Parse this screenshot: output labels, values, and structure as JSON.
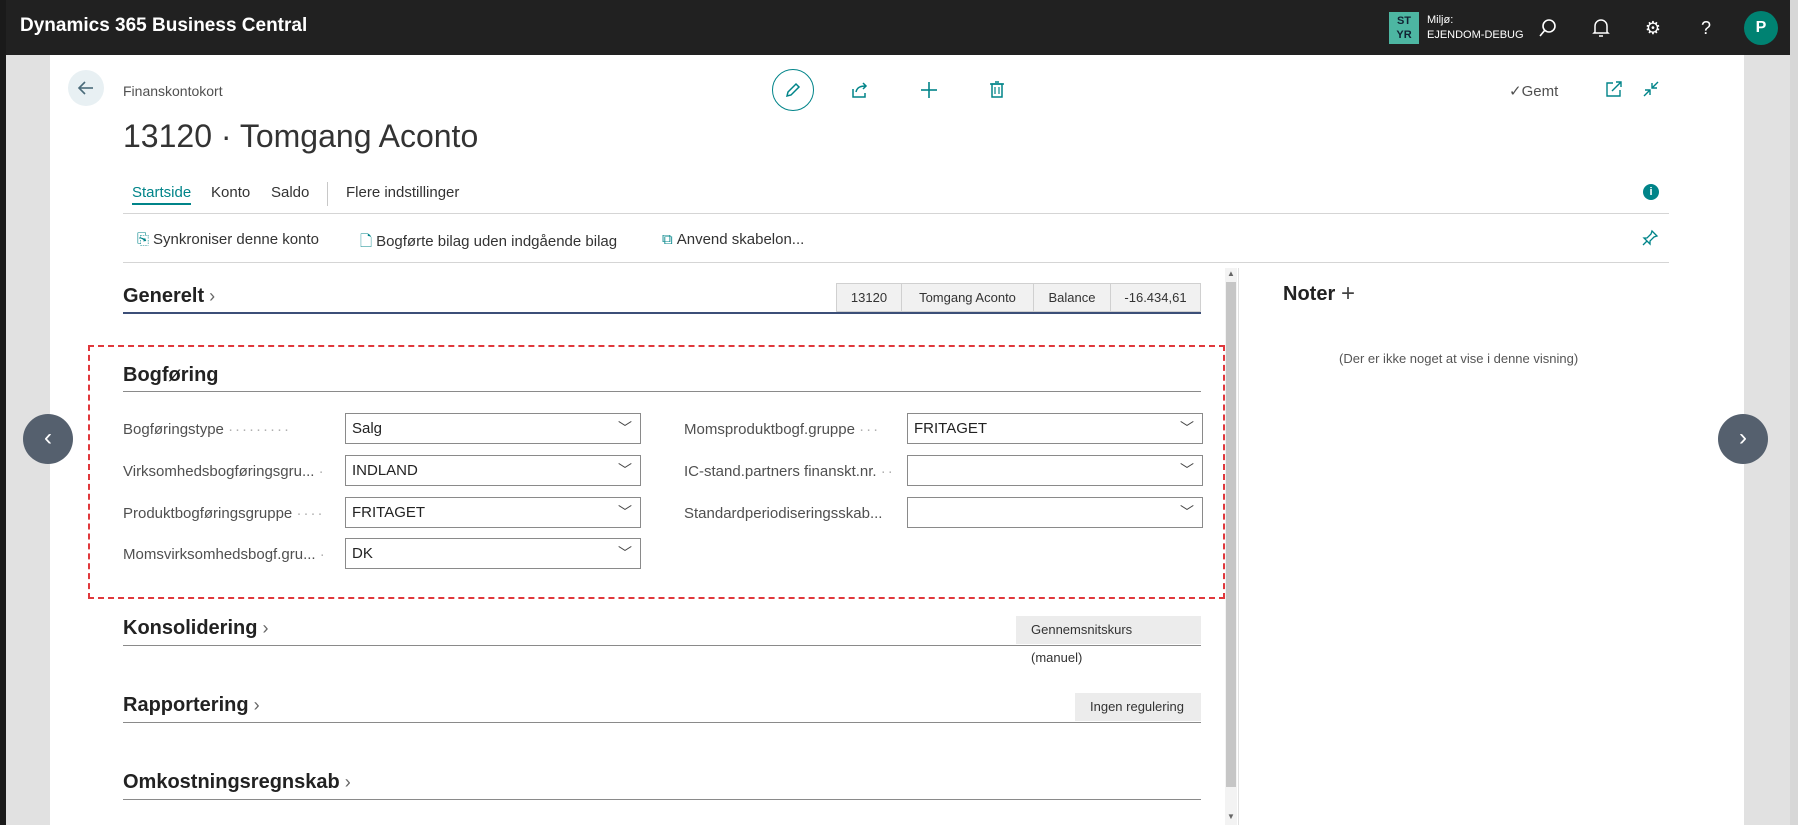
{
  "app": {
    "title": "Dynamics 365 Business Central"
  },
  "env": {
    "badge_top": "ST",
    "badge_bottom": "YR",
    "label_top": "Miljø:",
    "label_bottom": "EJENDOM-DEBUG"
  },
  "user": {
    "initial": "P"
  },
  "page": {
    "breadcrumb": "Finanskontokort",
    "title": "13120 · Tomgang Aconto",
    "saved_label": "Gemt"
  },
  "tabs": [
    "Startside",
    "Konto",
    "Saldo",
    "Flere indstillinger"
  ],
  "toolbar": {
    "sync": "Synkroniser denne konto",
    "posted_docs": "Bogførte bilag uden indgående bilag",
    "apply_template": "Anvend skabelon..."
  },
  "general": {
    "title": "Generelt",
    "facts": [
      "13120",
      "Tomgang Aconto",
      "Balance",
      "-16.434,61"
    ]
  },
  "posting": {
    "title": "Bogføring",
    "fields_left": [
      {
        "label": "Bogføringstype",
        "value": "Salg"
      },
      {
        "label": "Virksomhedsbogføringsgru...",
        "value": "INDLAND"
      },
      {
        "label": "Produktbogføringsgruppe",
        "value": "FRITAGET"
      },
      {
        "label": "Momsvirksomhedsbogf.gru...",
        "value": "DK"
      }
    ],
    "fields_right": [
      {
        "label": "Momsproduktbogf.gruppe",
        "value": "FRITAGET"
      },
      {
        "label": "IC-stand.partners finanskt.nr.",
        "value": ""
      },
      {
        "label": "Standardperiodiseringsskab...",
        "value": ""
      }
    ]
  },
  "consolidation": {
    "title": "Konsolidering",
    "badge": "Gennemsnitskurs (manuel)"
  },
  "reporting": {
    "title": "Rapportering",
    "badge": "Ingen regulering"
  },
  "costacc": {
    "title": "Omkostningsregnskab"
  },
  "notes": {
    "title": "Noter",
    "empty": "(Der er ikke noget at vise i denne visning)"
  },
  "colors": {
    "accent": "#008489",
    "topbar": "#212121",
    "highlight": "#e0383c"
  }
}
